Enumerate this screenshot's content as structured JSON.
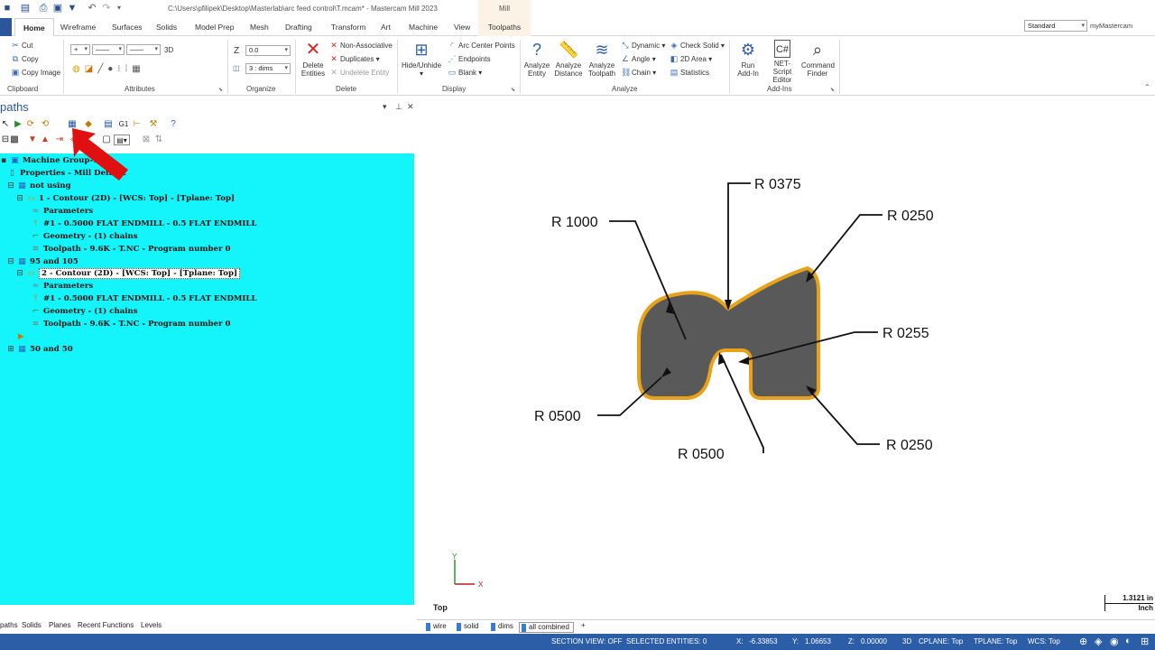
{
  "window": {
    "title": "C:\\Users\\pfilipek\\Desktop\\Masterlab\\arc feed control\\T.mcam* - Mastercam Mill 2023",
    "context_tab": "Mill"
  },
  "ribbon_tabs": [
    "Home",
    "Wireframe",
    "Surfaces",
    "Solids",
    "Model Prep",
    "Mesh",
    "Drafting",
    "Transform",
    "Art",
    "Machine",
    "View",
    "Toolpaths"
  ],
  "active_tab": "Home",
  "config": {
    "value": "Standard",
    "my_mastercam": "myMastercam"
  },
  "ribbon": {
    "clipboard": {
      "cut": "Cut",
      "copy": "Copy",
      "copy_image": "Copy Image",
      "label": "Clipboard"
    },
    "attributes": {
      "label": "Attributes",
      "three_d": "3D"
    },
    "organize": {
      "z_label": "Z",
      "z_value": "0.0",
      "level_value": "3 : dims",
      "label": "Organize"
    },
    "delete": {
      "delete_entities": "Delete\nEntities",
      "non_associative": "Non-Associative",
      "duplicates": "Duplicates",
      "undelete": "Undelete Entity",
      "label": "Delete"
    },
    "display": {
      "hide_unhide": "Hide/Unhide",
      "arc_center_points": "Arc Center Points",
      "endpoints": "Endpoints",
      "blank": "Blank",
      "label": "Display"
    },
    "analyze": {
      "analyze_entity": "Analyze\nEntity",
      "analyze_distance": "Analyze\nDistance",
      "analyze_toolpath": "Analyze\nToolpath",
      "dynamic": "Dynamic",
      "angle": "Angle",
      "chain": "Chain",
      "check_solid": "Check Solid",
      "area_2d": "2D Area",
      "statistics": "Statistics",
      "label": "Analyze"
    },
    "addins": {
      "run_addin": "Run\nAdd-In",
      "net_script": "NET-Script\nEditor",
      "command_finder": "Command\nFinder",
      "label": "Add-Ins"
    }
  },
  "manager": {
    "title": "paths",
    "tree": [
      {
        "text": "Machine Group-1",
        "icon": "machine-group-icon"
      },
      {
        "text": "Properties - Mill Default",
        "icon": "properties-icon"
      },
      {
        "text": "not using",
        "icon": "toolpath-group-icon"
      },
      {
        "text": "1 - Contour (2D) - [WCS: Top] - [Tplane: Top]",
        "icon": "operation-folder-icon"
      },
      {
        "text": "Parameters",
        "icon": "parameters-icon"
      },
      {
        "text": "#1 - 0.5000 FLAT ENDMILL - 0.5 FLAT ENDMILL",
        "icon": "tool-icon"
      },
      {
        "text": "Geometry - (1) chains",
        "icon": "geometry-icon"
      },
      {
        "text": "Toolpath - 9.6K - T.NC - Program number 0",
        "icon": "toolpath-icon"
      },
      {
        "text": "95 and 105",
        "icon": "toolpath-group-icon"
      },
      {
        "text": "2 - Contour (2D) - [WCS: Top] - [Tplane: Top]",
        "icon": "operation-folder-icon"
      },
      {
        "text": "Parameters",
        "icon": "parameters-icon"
      },
      {
        "text": "#1 - 0.5000 FLAT ENDMILL - 0.5 FLAT ENDMILL",
        "icon": "tool-icon"
      },
      {
        "text": "Geometry - (1) chains",
        "icon": "geometry-icon"
      },
      {
        "text": "Toolpath - 9.6K - T.NC - Program number 0",
        "icon": "toolpath-icon"
      },
      {
        "text": "50 and 50",
        "icon": "toolpath-group-icon"
      }
    ],
    "bottom_tabs": [
      "paths",
      "Solids",
      "Planes",
      "Recent Functions",
      "Levels"
    ]
  },
  "drawing": {
    "dimensions": [
      "R 1000",
      "R 0375",
      "R 0250",
      "R 0255",
      "R 0500",
      "R 0500",
      "R 0250"
    ],
    "axis_y": "Y",
    "axis_x": "X",
    "view_label": "Top",
    "scale_value": "1.3121 in",
    "scale_unit": "Inch",
    "colors": {
      "part_fill": "#595959",
      "part_outline": "#e8a21a",
      "tree_bg": "#13f5fb",
      "status_bar": "#2b5ea7",
      "arrow": "#e01010"
    }
  },
  "view_sheets": [
    "wire",
    "solid",
    "dims",
    "all combined",
    "+"
  ],
  "status": {
    "section_view": "SECTION VIEW: OFF",
    "selected_entities": "SELECTED ENTITIES: 0",
    "x_label": "X:",
    "x_value": "-6.33853",
    "y_label": "Y:",
    "y_value": "1.06653",
    "z_label": "Z:",
    "z_value": "0.00000",
    "mode": "3D",
    "cplane": "CPLANE: Top",
    "tplane": "TPLANE: Top",
    "wcs": "WCS: Top"
  }
}
